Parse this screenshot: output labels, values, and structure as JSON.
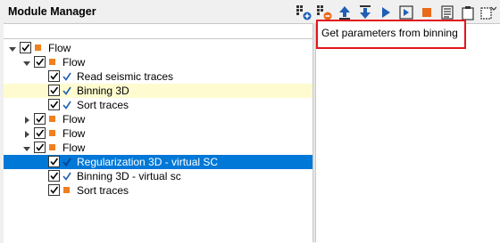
{
  "window": {
    "title": "Module Manager"
  },
  "toolbar": {
    "buttons": [
      {
        "name": "add-module-icon"
      },
      {
        "name": "remove-module-icon"
      },
      {
        "name": "move-up-icon"
      },
      {
        "name": "move-down-icon"
      },
      {
        "name": "run-icon"
      },
      {
        "name": "run-step-icon"
      },
      {
        "name": "stop-icon"
      },
      {
        "name": "parameters-icon"
      },
      {
        "name": "clipboard-icon"
      },
      {
        "name": "window-options-icon"
      }
    ]
  },
  "tooltip": {
    "text": "Get parameters from binning"
  },
  "tree": {
    "items": [
      {
        "label": "Flow",
        "level": 0,
        "expander": "down",
        "marker": "square",
        "checked": true
      },
      {
        "label": "Flow",
        "level": 1,
        "expander": "down",
        "marker": "square",
        "checked": true
      },
      {
        "label": "Read seismic traces",
        "level": 2,
        "expander": "none",
        "marker": "tick",
        "checked": true
      },
      {
        "label": "Binning 3D",
        "level": 2,
        "expander": "none",
        "marker": "tick",
        "checked": true,
        "state": "highlight"
      },
      {
        "label": "Sort traces",
        "level": 2,
        "expander": "none",
        "marker": "tick",
        "checked": true
      },
      {
        "label": "Flow",
        "level": 1,
        "expander": "right",
        "marker": "square",
        "checked": true
      },
      {
        "label": "Flow",
        "level": 1,
        "expander": "right",
        "marker": "square",
        "checked": true
      },
      {
        "label": "Flow",
        "level": 1,
        "expander": "down",
        "marker": "square",
        "checked": true
      },
      {
        "label": "Regularization 3D - virtual SC",
        "level": 2,
        "expander": "none",
        "marker": "tick",
        "checked": true,
        "state": "selected"
      },
      {
        "label": "Binning 3D - virtual sc",
        "level": 2,
        "expander": "none",
        "marker": "tick",
        "checked": true
      },
      {
        "label": "Sort traces",
        "level": 2,
        "expander": "none",
        "marker": "square",
        "checked": true
      }
    ]
  },
  "colors": {
    "accent_orange": "#f07f1f",
    "tick_blue": "#1f5fb5",
    "selection": "#0078d7",
    "highlight": "#fdfbcf",
    "tooltip_border": "#e0161d"
  }
}
